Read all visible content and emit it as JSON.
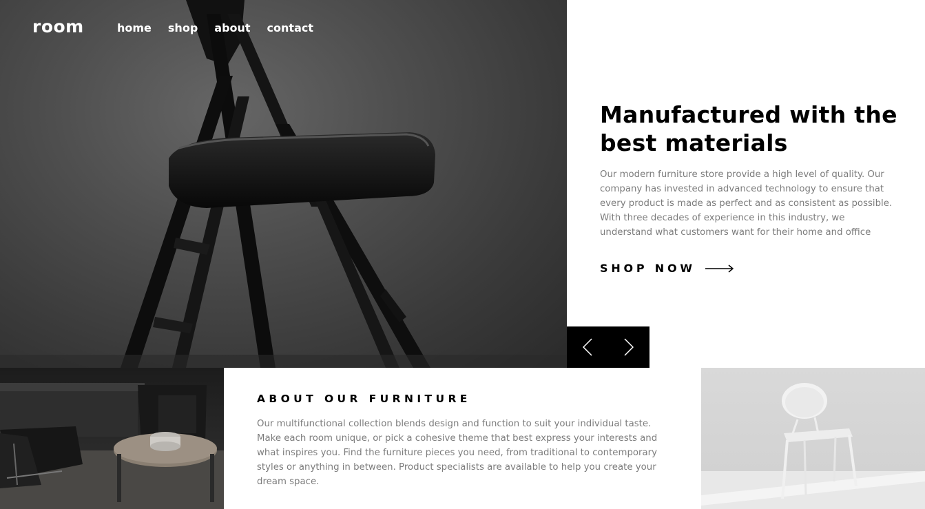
{
  "header": {
    "logo": "room",
    "nav": [
      {
        "label": "home"
      },
      {
        "label": "shop"
      },
      {
        "label": "about"
      },
      {
        "label": "contact"
      }
    ]
  },
  "hero": {
    "title": "Manufactured with the best materials",
    "body": "Our modern furniture store provide a high level of quality. Our company has invested in advanced technology to ensure that every product is made as perfect and as consistent as possible. With three decades of experience in this industry, we understand what customers want for their home and office",
    "cta_label": "SHOP NOW",
    "cta_icon": "arrow-right-icon",
    "image": "black-folding-chair-photo"
  },
  "slider": {
    "prev_icon": "chevron-left-icon",
    "next_icon": "chevron-right-icon"
  },
  "about": {
    "title": "ABOUT OUR FURNITURE",
    "body": "Our multifunctional collection blends design and function to suit your individual taste. Make each room unique, or pick a cohesive theme that best express your interests and what inspires you. Find the furniture pieces you need, from traditional to contemporary styles or anything in between. Product specialists are available to help you create your dream space.",
    "left_image": "dark-living-room-photo",
    "right_image": "white-chair-photo"
  },
  "colors": {
    "text_primary": "#000000",
    "text_secondary": "#7c7c7c",
    "background": "#ffffff",
    "control_bg": "#000000"
  }
}
